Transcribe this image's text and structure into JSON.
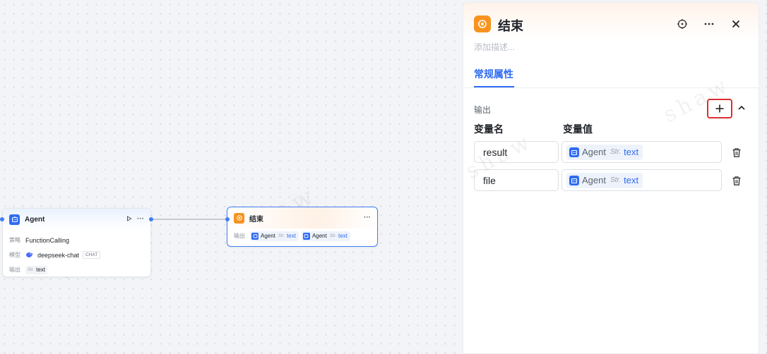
{
  "canvas": {
    "agent_node": {
      "title": "Agent",
      "rows": [
        {
          "label": "策略",
          "value": "FunctionCalling"
        },
        {
          "label": "模型",
          "value": "deepseek-chat",
          "tag": "CHAT"
        },
        {
          "label": "输出",
          "type": "Str.",
          "value": "text"
        }
      ]
    },
    "end_node": {
      "title": "结束",
      "output_label": "输出",
      "refs": [
        {
          "source": "Agent",
          "type": "Str.",
          "var": "text"
        },
        {
          "source": "Agent",
          "type": "Str.",
          "var": "text"
        }
      ]
    },
    "watermark": "shaw"
  },
  "panel": {
    "title": "结束",
    "description_placeholder": "添加描述...",
    "tab": "常规属性",
    "section_label": "输出",
    "col_name": "变量名",
    "col_value": "变量值",
    "outputs": [
      {
        "name": "result",
        "source": "Agent",
        "type": "Str.",
        "var": "text"
      },
      {
        "name": "file",
        "source": "Agent",
        "type": "Str.",
        "var": "text"
      }
    ]
  },
  "colors": {
    "accent": "#2f6bf2",
    "end_icon": "#f7931e",
    "highlight": "#e02d2d"
  }
}
